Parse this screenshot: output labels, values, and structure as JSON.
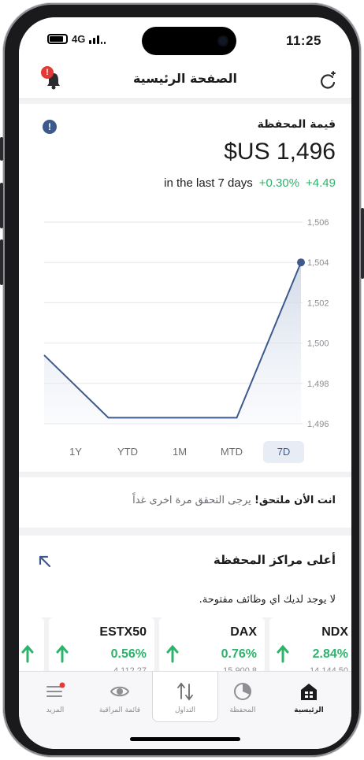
{
  "status_bar": {
    "network": "4G",
    "time": "11:25"
  },
  "header": {
    "title": "الصفحة الرئيسية",
    "notification_count": "!"
  },
  "portfolio": {
    "label": "قيمة المحفظة",
    "value": "$US 1,496",
    "period_text": "in the last 7 days",
    "change_pct": "+0.30%",
    "change_abs": "+4.49"
  },
  "chart_data": {
    "type": "line",
    "title": "",
    "xlabel": "",
    "ylabel": "",
    "y_ticks": [
      "1,506",
      "1,504",
      "1,502",
      "1,500",
      "1,498",
      "1,496"
    ],
    "ylim": [
      1496,
      1506
    ],
    "x": [
      0,
      1,
      2,
      3,
      4
    ],
    "series": [
      {
        "values": [
          1499.4,
          1496.3,
          1496.3,
          1496.3,
          1504.0
        ]
      }
    ],
    "grid": true,
    "color": "#3d5a8c"
  },
  "ranges": [
    {
      "label": "1Y"
    },
    {
      "label": "YTD"
    },
    {
      "label": "1M"
    },
    {
      "label": "MTD"
    },
    {
      "label": "7D"
    }
  ],
  "active_range": "7D",
  "notice": {
    "bold": "انت الأن ملتحق!",
    "text": "يرجى التحقق مرة اخرى غداً"
  },
  "positions": {
    "title": "أعلى مراكز المحفظة",
    "empty_text": "لا يوجد لديك اي وظائف مفتوحة."
  },
  "tickers": [
    {
      "name": "NDX",
      "pct": "2.84%",
      "price": "14,144.50"
    },
    {
      "name": "DAX",
      "pct": "0.76%",
      "price": "15,900.8"
    },
    {
      "name": "ESTX50",
      "pct": "0.56%",
      "price": "4,112.27"
    }
  ],
  "tabbar": {
    "home": "الرئيسية",
    "portfolio": "المحفظة",
    "trade": "التداول",
    "watchlist": "قائمة المراقبة",
    "more": "المزيد"
  },
  "colors": {
    "accent": "#3d5a8c",
    "positive": "#2db36b",
    "alert": "#e53935"
  }
}
